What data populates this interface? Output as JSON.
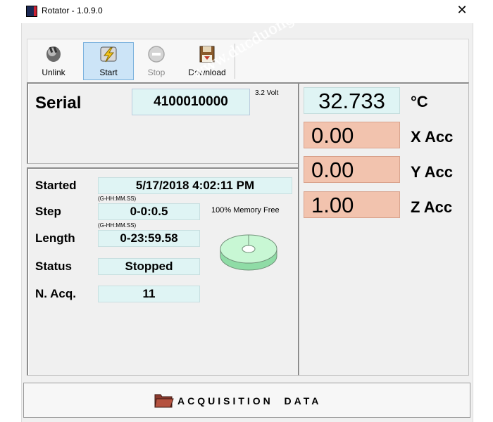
{
  "window": {
    "title": "Rotator - 1.0.9.0"
  },
  "toolbar": {
    "unlink_label": "Unlink",
    "start_label": "Start",
    "stop_label": "Stop",
    "download_label": "Download"
  },
  "serial": {
    "label": "Serial",
    "value": "4100010000",
    "voltage": "3.2 Volt"
  },
  "info": {
    "started_label": "Started",
    "started_value": "5/17/2018 4:02:11 PM",
    "step_label": "Step",
    "step_hint": "(G-HH:MM.SS)",
    "step_value": "0-0:0.5",
    "length_label": "Length",
    "length_hint": "(G-HH:MM.SS)",
    "length_value": "0-23:59.58",
    "status_label": "Status",
    "status_value": "Stopped",
    "nacq_label": "N. Acq.",
    "nacq_value": "11",
    "memory_text": "100% Memory Free",
    "memory_free_fraction": 1.0
  },
  "sensors": {
    "temperature_value": "32.733",
    "temperature_unit": "°C",
    "x_value": "0.00",
    "x_label": "X Acc",
    "y_value": "0.00",
    "y_label": "Y Acc",
    "z_value": "1.00",
    "z_label": "Z Acc"
  },
  "bottom": {
    "acquisition_label": "ACQUISITION  DATA"
  },
  "watermark": "www.ducduong.com",
  "colors": {
    "value_box_cyan": "#dff4f4",
    "value_box_salmon": "#f2c3ae",
    "start_highlight": "#cce4f7",
    "memory_disk": "#b8f0c8"
  },
  "icons": {
    "unlink": "unlink-plug-icon",
    "start": "lightning-icon",
    "stop": "stop-icon",
    "download": "floppy-download-icon",
    "acquisition": "folder-icon",
    "memory": "memory-disk-icon",
    "close": "close-icon"
  }
}
